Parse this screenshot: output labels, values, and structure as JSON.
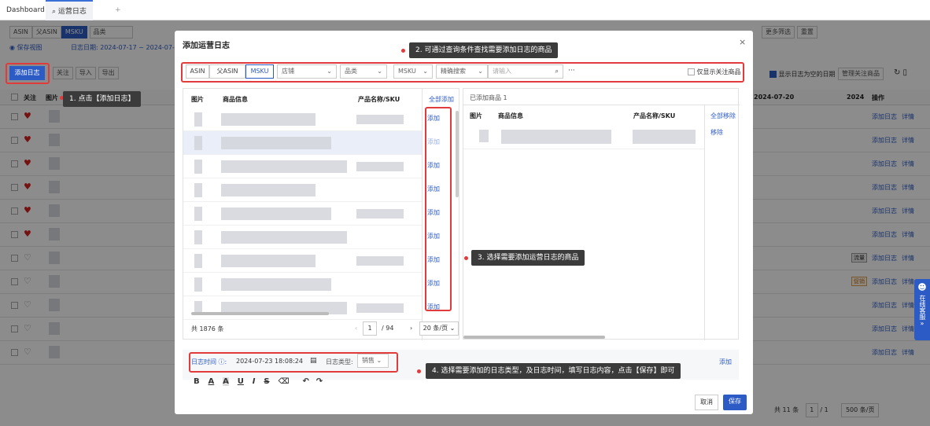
{
  "tabs": {
    "dashboard": "Dashboard",
    "current": "运营日志",
    "add": "+"
  },
  "background": {
    "filter_segments": [
      "ASIN",
      "父ASIN",
      "MSKU"
    ],
    "category": "品类",
    "save_view": "保存视图",
    "date_range": "日志日期: 2024-07-17 ~ 2024-07-",
    "more_filter": "更多筛选",
    "reset": "重置",
    "add_log": "添加日志",
    "follow": "关注",
    "import": "导入",
    "export": "导出",
    "show_empty": "显示日志为空的日期",
    "manage_follow": "管理关注商品",
    "col_follow": "关注",
    "col_image": "图片",
    "col_date1": "2024-07-20",
    "col_date2": "2024",
    "col_ops": "操作",
    "row_add": "添加日志",
    "row_detail": "详情",
    "badge_a": "流量",
    "badge_b": "促销",
    "total": "共 11 条",
    "page_current": "1",
    "page_total": "/ 1",
    "page_size": "500 条/页",
    "rows_followed": [
      true,
      true,
      true,
      true,
      true,
      true,
      false,
      false,
      false,
      false,
      false
    ]
  },
  "modal": {
    "title": "添加运营日志",
    "close": "×",
    "segments": [
      "ASIN",
      "父ASIN",
      "MSKU"
    ],
    "shop": "店铺",
    "category": "品类",
    "msku": "MSKU",
    "search_mode": "精确搜索",
    "search_placeholder": "请输入",
    "only_follow": "仅显示关注商品",
    "left_cols": {
      "image": "图片",
      "info": "商品信息",
      "name_sku": "产品名称/SKU",
      "add_all": "全部添加"
    },
    "add": "添加",
    "right_header": "已添加商品 1",
    "right_cols": {
      "image": "图片",
      "info": "商品信息",
      "name_sku": "产品名称/SKU",
      "remove_all": "全部移除"
    },
    "remove": "移除",
    "left_total": "共 1876 条",
    "page_current": "1",
    "page_total": "/ 94",
    "page_size": "20 条/页",
    "log_time_label": "日志时间",
    "log_time_value": "2024-07-23 18:08:24",
    "log_type_label": "日志类型:",
    "log_type_value": "销售",
    "add_link": "添加",
    "editor_tools": [
      "B",
      "A",
      "A",
      "U",
      "I",
      "S",
      "⌫",
      "↶",
      "↷"
    ],
    "cancel": "取消",
    "save": "保存"
  },
  "callouts": {
    "step1": "1. 点击【添加日志】",
    "step2": "2. 可通过查询条件查找需要添加日志的商品",
    "step3": "3. 选择需要添加运营日志的商品",
    "step4": "4. 选择需要添加的日志类型，及日志时间，填写日志内容，点击【保存】即可"
  },
  "side_widget": {
    "label": "在线客服",
    "icon": "chat-icon"
  },
  "colors": {
    "primary": "#2d5bc5",
    "annotation": "#e23b3b",
    "callout_bg": "#3b3b3b"
  }
}
